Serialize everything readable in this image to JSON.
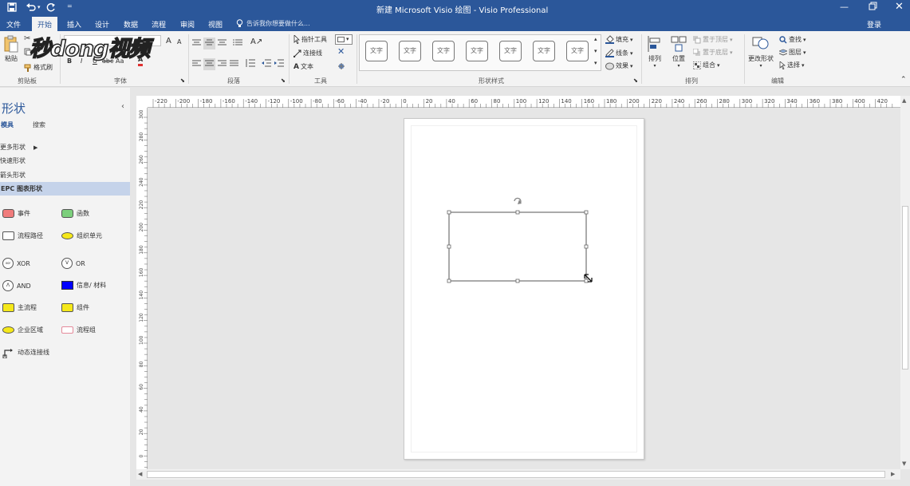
{
  "titlebar": {
    "title": "新建 Microsoft Visio 绘图 - Visio Professional",
    "quick_extra": "="
  },
  "tabs": [
    "文件",
    "开始",
    "插入",
    "设计",
    "数据",
    "流程",
    "审阅",
    "视图"
  ],
  "active_tab": "开始",
  "tell_me": "告诉我你想要做什么...",
  "signin": "登录",
  "ribbon": {
    "clipboard": {
      "paste": "粘贴",
      "format_painter": "格式刷",
      "label": "剪贴板"
    },
    "font": {
      "label": "字体",
      "bold": "B",
      "italic": "I",
      "underline": "U",
      "size_btn": "Aa",
      "color_btn": "A"
    },
    "paragraph": {
      "label": "段落"
    },
    "tools": {
      "pointer": "指针工具",
      "connector": "连接线",
      "text": "文本",
      "label": "工具"
    },
    "shape_styles": {
      "sample": "文字",
      "label": "形状样式",
      "fill": "填充",
      "line": "线条",
      "effects": "效果"
    },
    "arrange": {
      "align": "排列",
      "position": "位置",
      "bring_front": "置于顶层",
      "send_back": "置于底层",
      "group": "组合",
      "label": "排列"
    },
    "editing": {
      "change_shape": "更改形状",
      "find": "查找",
      "layers": "图层",
      "select": "选择",
      "label": "编辑"
    }
  },
  "watermark": "秒dong视频",
  "left_panel": {
    "title": "形状",
    "tab_stencil": "模具",
    "tab_search": "搜索",
    "more_shapes": "更多形状",
    "stencils": [
      "快速形状",
      "箭头形状",
      "EPC 图表形状"
    ],
    "shapes": [
      {
        "label": "事件",
        "icon": "rounded-rect-red-icon"
      },
      {
        "label": "函数",
        "icon": "rounded-rect-green-icon"
      },
      {
        "label": "流程路径",
        "icon": "rect-outline-icon"
      },
      {
        "label": "组织单元",
        "icon": "ellipse-yellow-icon"
      },
      {
        "label": "XOR",
        "icon": "xor-circle-icon",
        "glyph": "xor"
      },
      {
        "label": "OR",
        "icon": "or-circle-icon",
        "glyph": "V"
      },
      {
        "label": "AND",
        "icon": "and-circle-icon",
        "glyph": "Λ"
      },
      {
        "label": "信息/ 材料",
        "icon": "rect-blue-icon"
      },
      {
        "label": "主流程",
        "icon": "rect-yellow-icon"
      },
      {
        "label": "组件",
        "icon": "rect-yellow-icon"
      },
      {
        "label": "企业区域",
        "icon": "ellipse-yellow-icon"
      },
      {
        "label": "流程组",
        "icon": "rect-pink-outline-icon"
      },
      {
        "label": "动态连接线",
        "icon": "connector-icon"
      }
    ]
  },
  "rulers": {
    "horizontal": [
      -220,
      -200,
      -180,
      -160,
      -140,
      -120,
      -100,
      -80,
      -60,
      -40,
      -20,
      0,
      20,
      40,
      60,
      80,
      100,
      120,
      140,
      160,
      180,
      200,
      220,
      240,
      260,
      280,
      300,
      320,
      340,
      360,
      380,
      400,
      420
    ],
    "vertical": [
      300,
      280,
      260,
      240,
      220,
      200,
      180,
      160,
      140,
      120,
      100,
      80,
      60,
      40,
      20,
      0
    ]
  },
  "colors": {
    "accent": "#2b579a",
    "event": "#f07c7c",
    "function": "#7ccf7c",
    "yellow": "#f5e81a",
    "info": "#0000ff"
  }
}
